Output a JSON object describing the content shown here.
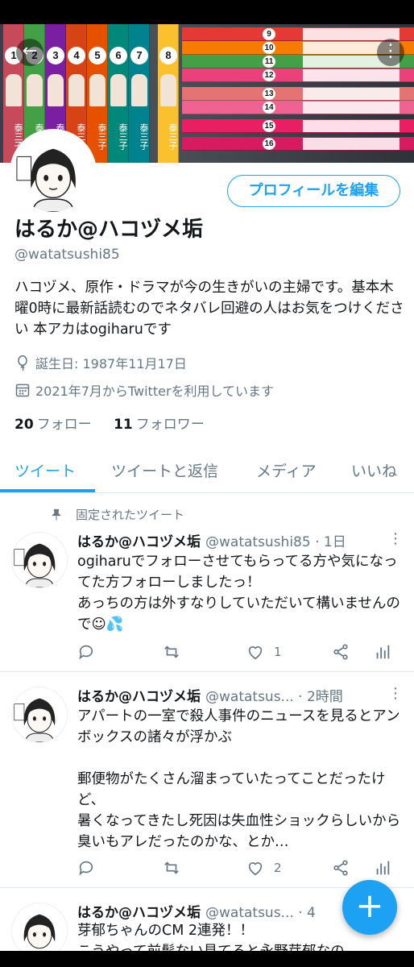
{
  "profile": {
    "name": "はるか@ハコヅメ垢",
    "handle": "@watatsushi85",
    "edit_label": "プロフィールを編集",
    "bio": "ハコヅメ、原作・ドラマが今の生きがいの主婦です。基本木曜0時に最新話読むのでネタバレ回避の人はお気をつけください 本アカはogiharuです",
    "birth": "誕生日: 1987年11月17日",
    "joined": "2021年7月からTwitterを利用しています",
    "following_count": "20",
    "following_label": "フォロー",
    "followers_count": "11",
    "followers_label": "フォロワー"
  },
  "banner": {
    "spines": [
      "1",
      "2",
      "3",
      "4",
      "5",
      "6",
      "7",
      "8"
    ],
    "spine_text": "泰三子",
    "hspines": [
      "9",
      "10",
      "11",
      "12",
      "13",
      "14",
      "15",
      "16"
    ]
  },
  "tabs": [
    {
      "label": "ツイート"
    },
    {
      "label": "ツイートと返信"
    },
    {
      "label": "メディア"
    },
    {
      "label": "いいね"
    }
  ],
  "tweets": [
    {
      "pinned_label": "固定されたツイート",
      "author": "はるか@ハコヅメ垢",
      "meta": "@watatsushi85 · 1日",
      "text": "ogiharuでフォローさせてもらってる方や気になってた方フォローしましたっ！\nあっちの方は外すなりしていただいて構いませんので",
      "emoji": "☺💦",
      "likes": "1"
    },
    {
      "author": "はるか@ハコヅメ垢",
      "meta": "@watatsus... · 2時間",
      "text": "アパートの一室で殺人事件のニュースを見るとアンボックスの諸々が浮かぶ\n\n郵便物がたくさん溜まっていたってことだったけど、\n暑くなってきたし死因は失血性ショックらしいから臭いもアレだったのかな、とか…",
      "likes": "2"
    },
    {
      "author": "はるか@ハコヅメ垢",
      "meta": "@watatsus... · 4",
      "text": "芽郁ちゃんのCM 2連発！！\nこうやって前髪ない見てると永野芽郁なの"
    }
  ],
  "colors": {
    "accent": "#1da1f2",
    "muted": "#657786",
    "text": "#14171a"
  }
}
